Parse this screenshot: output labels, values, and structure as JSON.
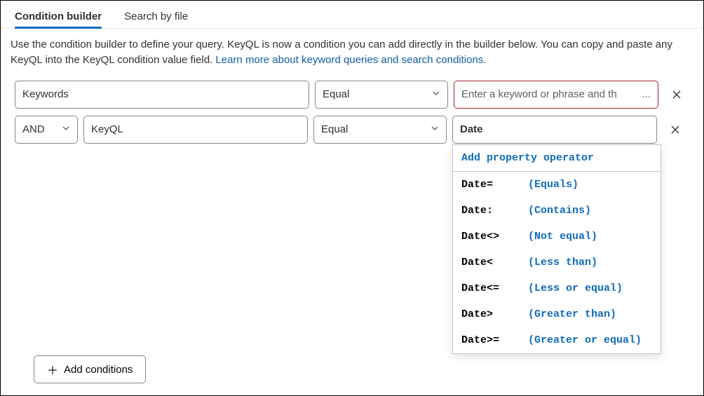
{
  "tabs": {
    "builder": "Condition builder",
    "byFile": "Search by file"
  },
  "description": {
    "text": "Use the condition builder to define your query. KeyQL is now a condition you can add directly in the builder below. You can copy and paste any KeyQL into the KeyQL condition value field. ",
    "link": "Learn more about keyword queries and search conditions."
  },
  "row1": {
    "property": "Keywords",
    "operator": "Equal",
    "valuePlaceholder": "Enter a keyword or phrase and th"
  },
  "row2": {
    "logic": "AND",
    "property": "KeyQL",
    "operator": "Equal",
    "value": "Date"
  },
  "dropdown": {
    "header": "Add property operator",
    "items": [
      {
        "key": "Date=",
        "desc": "(Equals)"
      },
      {
        "key": "Date:",
        "desc": "(Contains)"
      },
      {
        "key": "Date<>",
        "desc": "(Not equal)"
      },
      {
        "key": "Date<",
        "desc": "(Less than)"
      },
      {
        "key": "Date<=",
        "desc": "(Less or equal)"
      },
      {
        "key": "Date>",
        "desc": "(Greater than)"
      },
      {
        "key": "Date>=",
        "desc": "(Greater or equal)"
      }
    ]
  },
  "addButton": "Add conditions"
}
